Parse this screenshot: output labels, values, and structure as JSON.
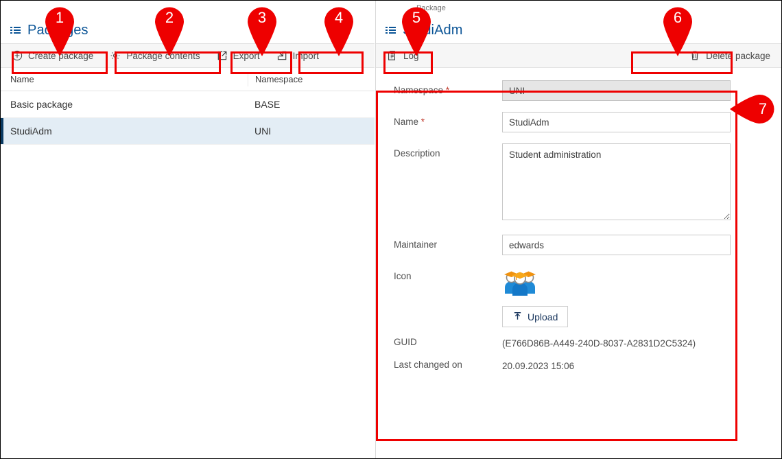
{
  "left_panel": {
    "icon": "list-icon",
    "title": "Packages",
    "toolbar": [
      {
        "label": "Create package",
        "icon": "plus-circle-icon"
      },
      {
        "label": "Package contents",
        "icon": "gear-icon"
      },
      {
        "label": "Export",
        "icon": "export-arrow-icon"
      },
      {
        "label": "Import",
        "icon": "import-arrow-icon"
      }
    ],
    "table": {
      "columns": [
        "Name",
        "Namespace"
      ],
      "rows": [
        {
          "name": "Basic package",
          "namespace": "BASE",
          "selected": false
        },
        {
          "name": "StudiAdm",
          "namespace": "UNI",
          "selected": true
        }
      ]
    }
  },
  "right_panel": {
    "supertitle": "Package",
    "icon": "list-icon",
    "title": "StudiAdm",
    "toolbar_left": [
      {
        "label": "Log",
        "icon": "log-document-icon"
      }
    ],
    "toolbar_right": [
      {
        "label": "Delete package",
        "icon": "trash-icon"
      }
    ],
    "form": {
      "namespace": {
        "label": "Namespace",
        "required": "*",
        "value": "UNI",
        "disabled": true
      },
      "name": {
        "label": "Name",
        "required": "*",
        "value": "StudiAdm",
        "disabled": false
      },
      "description": {
        "label": "Description",
        "value": "Student administration"
      },
      "maintainer": {
        "label": "Maintainer",
        "value": "edwards"
      },
      "icon": {
        "label": "Icon",
        "image": "students-group-icon",
        "upload_label": "Upload",
        "upload_icon": "upload-arrow-icon"
      },
      "guid": {
        "label": "GUID",
        "value": "(E766D86B-A449-240D-8037-A2831D2C5324)"
      },
      "last_changed": {
        "label": "Last changed on",
        "value": "20.09.2023 15:06"
      }
    }
  },
  "annotations": {
    "color": "#ee0000",
    "pins": [
      {
        "id": "1",
        "label": "1"
      },
      {
        "id": "2",
        "label": "2"
      },
      {
        "id": "3",
        "label": "3"
      },
      {
        "id": "4",
        "label": "4"
      },
      {
        "id": "5",
        "label": "5"
      },
      {
        "id": "6",
        "label": "6"
      },
      {
        "id": "7",
        "label": "7"
      }
    ]
  },
  "colors": {
    "accent_blue": "#0a5496",
    "selected_row": "#e3edf5",
    "selected_marker": "#0a3a63",
    "toolbar_bg": "#f6f6f6",
    "annotation_red": "#ee0000",
    "required_star": "#c0392b"
  }
}
